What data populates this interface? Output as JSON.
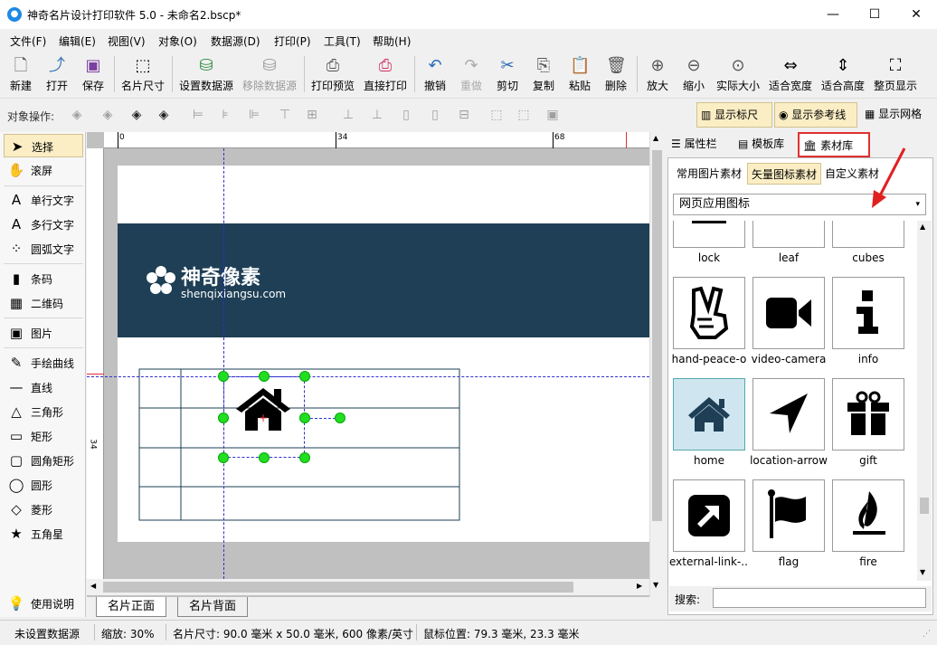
{
  "window": {
    "title": "神奇名片设计打印软件 5.0 - 未命名2.bscp*",
    "minimize": "—",
    "maximize": "☐",
    "close": "✕"
  },
  "menu": [
    "文件(F)",
    "编辑(E)",
    "视图(V)",
    "对象(O)",
    "数据源(D)",
    "打印(P)",
    "工具(T)",
    "帮助(H)"
  ],
  "toolbar": [
    {
      "label": "新建",
      "icon": "new-doc-icon"
    },
    {
      "label": "打开",
      "icon": "open-icon"
    },
    {
      "label": "保存",
      "icon": "save-icon"
    },
    {
      "label": "名片尺寸",
      "icon": "card-size-icon"
    },
    {
      "label": "设置数据源",
      "icon": "database-icon"
    },
    {
      "label": "移除数据源",
      "icon": "database-remove-icon"
    },
    {
      "label": "打印预览",
      "icon": "print-preview-icon"
    },
    {
      "label": "直接打印",
      "icon": "printer-icon"
    },
    {
      "label": "撤销",
      "icon": "undo-icon"
    },
    {
      "label": "重做",
      "icon": "redo-icon"
    },
    {
      "label": "剪切",
      "icon": "scissors-icon"
    },
    {
      "label": "复制",
      "icon": "copy-icon"
    },
    {
      "label": "粘贴",
      "icon": "paste-icon"
    },
    {
      "label": "删除",
      "icon": "trash-icon"
    },
    {
      "label": "放大",
      "icon": "zoom-in-icon"
    },
    {
      "label": "缩小",
      "icon": "zoom-out-icon"
    },
    {
      "label": "实际大小",
      "icon": "actual-size-icon"
    },
    {
      "label": "适合宽度",
      "icon": "fit-width-icon"
    },
    {
      "label": "适合高度",
      "icon": "fit-height-icon"
    },
    {
      "label": "整页显示",
      "icon": "fit-page-icon"
    }
  ],
  "objbar": {
    "label": "对象操作:",
    "show_ruler": "显示标尺",
    "show_guides": "显示参考线",
    "show_grid": "显示网格"
  },
  "tools": [
    {
      "label": "选择",
      "icon": "arrow-cursor-icon",
      "glyph": "➤"
    },
    {
      "label": "滚屏",
      "icon": "hand-icon",
      "glyph": "✋"
    },
    {
      "label": "单行文字",
      "icon": "text-line-icon",
      "glyph": "A"
    },
    {
      "label": "多行文字",
      "icon": "text-multiline-icon",
      "glyph": "A"
    },
    {
      "label": "圆弧文字",
      "icon": "text-arc-icon",
      "glyph": "⁘"
    },
    {
      "label": "条码",
      "icon": "barcode-icon",
      "glyph": "▮"
    },
    {
      "label": "二维码",
      "icon": "qrcode-icon",
      "glyph": "▦"
    },
    {
      "label": "图片",
      "icon": "image-icon",
      "glyph": "▣"
    },
    {
      "label": "手绘曲线",
      "icon": "pencil-icon",
      "glyph": "✎"
    },
    {
      "label": "直线",
      "icon": "line-icon",
      "glyph": "—"
    },
    {
      "label": "三角形",
      "icon": "triangle-icon",
      "glyph": "△"
    },
    {
      "label": "矩形",
      "icon": "rectangle-icon",
      "glyph": "▭"
    },
    {
      "label": "圆角矩形",
      "icon": "rounded-rect-icon",
      "glyph": "▢"
    },
    {
      "label": "圆形",
      "icon": "circle-icon",
      "glyph": "◯"
    },
    {
      "label": "菱形",
      "icon": "diamond-icon",
      "glyph": "◇"
    },
    {
      "label": "五角星",
      "icon": "star-icon",
      "glyph": "★"
    },
    {
      "label": "使用说明",
      "icon": "lightbulb-icon",
      "glyph": "💡"
    }
  ],
  "ruler": {
    "h_ticks": [
      "0",
      "34",
      "68"
    ],
    "v_tick": "34"
  },
  "card": {
    "brand": "神奇像素",
    "brand_sub": "shenqixiangsu.com",
    "header_color": "#1e3f55"
  },
  "page_tabs": [
    "名片正面",
    "名片背面"
  ],
  "right_tabs": [
    "属性栏",
    "模板库",
    "素材库"
  ],
  "sub_tabs": [
    "常用图片素材",
    "矢量图标素材",
    "自定义素材"
  ],
  "category": "网页应用图标",
  "icons_row0": [
    "lock",
    "leaf",
    "cubes"
  ],
  "icons": [
    {
      "name": "hand-peace-o",
      "icon": "hand-peace-icon"
    },
    {
      "name": "video-camera",
      "icon": "video-camera-icon"
    },
    {
      "name": "info",
      "icon": "info-icon"
    },
    {
      "name": "home",
      "icon": "home-icon"
    },
    {
      "name": "location-arrow",
      "icon": "location-arrow-icon"
    },
    {
      "name": "gift",
      "icon": "gift-icon"
    },
    {
      "name": "external-link-...",
      "icon": "external-link-icon"
    },
    {
      "name": "flag",
      "icon": "flag-icon"
    },
    {
      "name": "fire",
      "icon": "fire-icon"
    }
  ],
  "search_label": "搜索:",
  "status": {
    "datasource": "未设置数据源",
    "zoom": "缩放: 30%",
    "size": "名片尺寸: 90.0 毫米 x 50.0 毫米, 600 像素/英寸",
    "mouse": "鼠标位置: 79.3 毫米, 23.3 毫米"
  }
}
